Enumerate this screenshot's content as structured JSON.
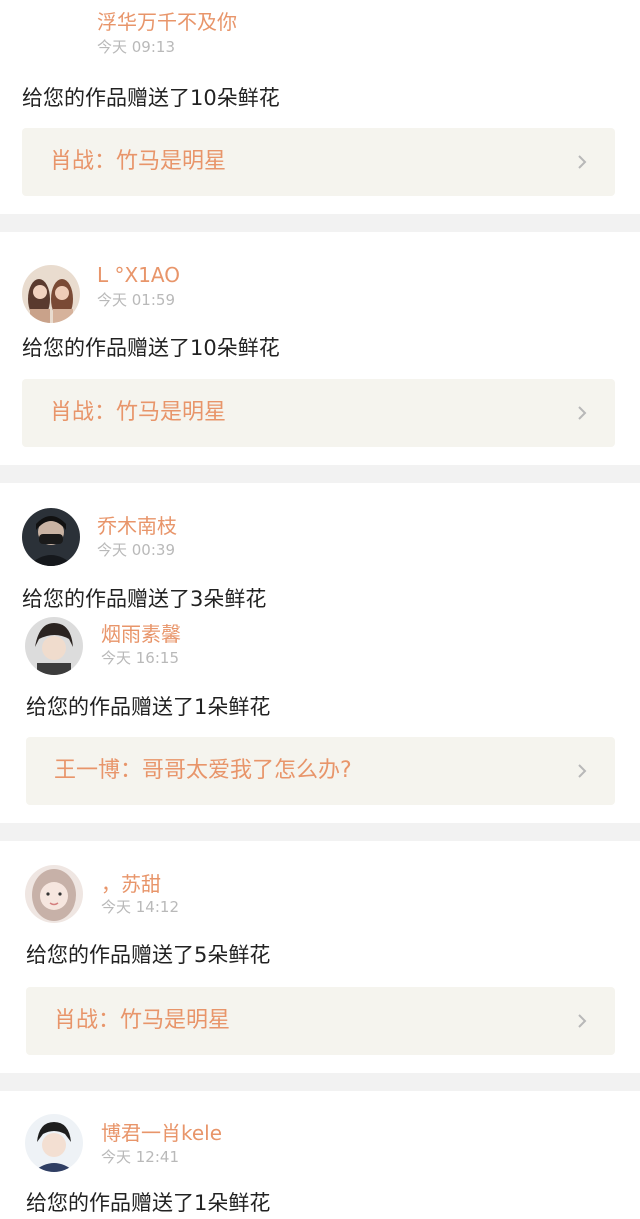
{
  "notifications": [
    {
      "username": "浮华万千不及你",
      "time": "今天 09:13",
      "message": "给您的作品赠送了10朵鲜花",
      "work": "肖战：竹马是明星"
    },
    {
      "username": "L °X1AO",
      "time": "今天 01:59",
      "message": "给您的作品赠送了10朵鲜花",
      "work": "肖战：竹马是明星"
    },
    {
      "username": "乔木南枝",
      "time": "今天 00:39",
      "message": "给您的作品赠送了3朵鲜花"
    },
    {
      "username": "烟雨素馨",
      "time": "今天 16:15",
      "message": "给您的作品赠送了1朵鲜花",
      "work": "王一博：哥哥太爱我了怎么办?"
    },
    {
      "username": "，苏甜",
      "time": "今天 14:12",
      "message": "给您的作品赠送了5朵鲜花",
      "work": "肖战：竹马是明星"
    },
    {
      "username": "博君一肖kele",
      "time": "今天 12:41",
      "message": "给您的作品赠送了1朵鲜花"
    }
  ],
  "icons": {
    "chevron": "chevron-right-icon",
    "avatar": "avatar"
  },
  "colors": {
    "accent": "#e8956a",
    "timestamp": "#b9b9b9",
    "card_bg": "#f5f4ee",
    "divider": "#f2f2f2"
  }
}
